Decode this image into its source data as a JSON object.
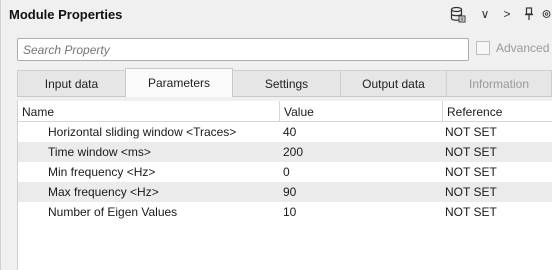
{
  "window": {
    "title": "Module Properties"
  },
  "toolbar": {
    "db_icon": "database-icon",
    "chevron": "∨",
    "arrow": ">",
    "pin_icon": "pin-icon"
  },
  "search": {
    "placeholder": "Search Property",
    "value": ""
  },
  "advanced": {
    "label": "Advanced",
    "checked": false
  },
  "tabs": [
    {
      "label": "Input data",
      "state": "normal"
    },
    {
      "label": "Parameters",
      "state": "active"
    },
    {
      "label": "Settings",
      "state": "normal"
    },
    {
      "label": "Output data",
      "state": "normal"
    },
    {
      "label": "Information",
      "state": "disabled"
    }
  ],
  "grid": {
    "columns": [
      "Name",
      "Value",
      "Reference"
    ],
    "rows": [
      {
        "name": "Horizontal sliding window <Traces>",
        "value": "40",
        "reference": "NOT SET"
      },
      {
        "name": "Time window <ms>",
        "value": "200",
        "reference": "NOT SET"
      },
      {
        "name": "Min frequency <Hz>",
        "value": "0",
        "reference": "NOT SET"
      },
      {
        "name": "Max frequency <Hz>",
        "value": "90",
        "reference": "NOT SET"
      },
      {
        "name": "Number of Eigen Values",
        "value": "10",
        "reference": "NOT SET"
      }
    ]
  }
}
